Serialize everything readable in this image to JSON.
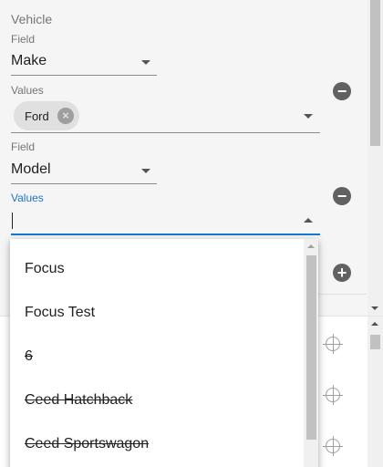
{
  "section": {
    "title": "Vehicle"
  },
  "filter1": {
    "field_label": "Field",
    "field_value": "Make",
    "values_label": "Values",
    "chips": [
      "Ford"
    ]
  },
  "filter2": {
    "field_label": "Field",
    "field_value": "Model",
    "values_label": "Values",
    "input_value": ""
  },
  "buttons": {
    "remove_symbol": "−",
    "add_symbol": "+"
  },
  "dropdown": {
    "options": [
      {
        "label": "Focus",
        "disabled": false
      },
      {
        "label": "Focus Test",
        "disabled": false
      },
      {
        "label": "6",
        "disabled": true
      },
      {
        "label": "Ceed Hatchback",
        "disabled": true
      },
      {
        "label": "Ceed Sportswagon",
        "disabled": true
      }
    ]
  },
  "icons": {
    "remove": "minus-circle-icon",
    "add": "plus-circle-icon",
    "chip_remove": "cancel-icon",
    "locate": "crosshair-icon"
  },
  "colors": {
    "accent": "#1976d2",
    "chip_bg": "#e0e0e0",
    "icon_dark": "#616161"
  }
}
